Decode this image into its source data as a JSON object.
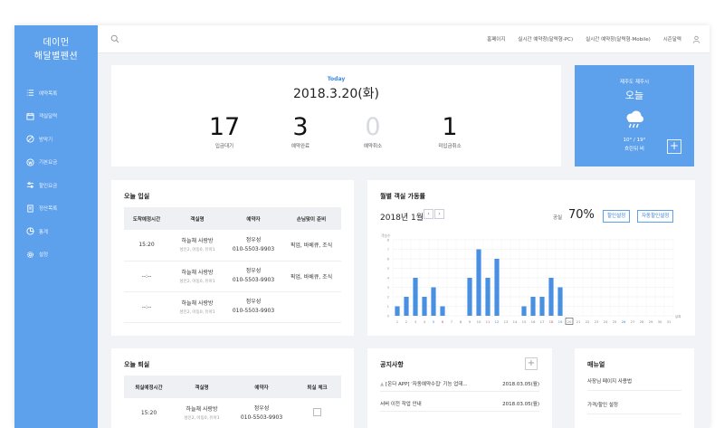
{
  "app": {
    "logo_line1": "데이먼",
    "logo_line2": "해달별펜션"
  },
  "sidebar": {
    "items": [
      {
        "label": "예약목록",
        "icon": "list-icon"
      },
      {
        "label": "객실달력",
        "icon": "calendar-icon"
      },
      {
        "label": "방막기",
        "icon": "block-icon"
      },
      {
        "label": "기본요금",
        "icon": "won-icon"
      },
      {
        "label": "할인요금",
        "icon": "sliders-icon"
      },
      {
        "label": "정산목록",
        "icon": "receipt-icon"
      },
      {
        "label": "통계",
        "icon": "pie-icon"
      },
      {
        "label": "설정",
        "icon": "gear-icon"
      }
    ]
  },
  "topbar": {
    "links": [
      "홈페이지",
      "실시간 예약창(달력형-PC)",
      "실시간 예약창(달력형-Mobile)",
      "시즌달력"
    ]
  },
  "today": {
    "label": "Today",
    "date": "2018.3.20(화)",
    "stats": [
      {
        "value": "17",
        "label": "입금대기"
      },
      {
        "value": "3",
        "label": "예약완료"
      },
      {
        "value": "0",
        "label": "예약취소"
      },
      {
        "value": "1",
        "label": "미입금취소"
      }
    ]
  },
  "weather": {
    "location": "제주도 제주시",
    "day": "오늘",
    "icon": "rain-cloud-icon",
    "temp": "10° / 19°",
    "condition": "흐린뒤 비"
  },
  "checkin": {
    "title": "오늘 입실",
    "headers": [
      "도착예정시간",
      "객실명",
      "예약자",
      "손님맞이 준비"
    ],
    "rows": [
      {
        "time": "15:20",
        "room": "하늘채 사랑방",
        "guests": "성인2, 아동0, 유아1",
        "name": "정우성",
        "phone": "010-5503-9903",
        "prep": "픽업, 바베큐, 조식"
      },
      {
        "time": "--:--",
        "room": "하늘채 사랑방",
        "guests": "성인2, 아동0, 유아1",
        "name": "정우성",
        "phone": "010-5503-9903",
        "prep": "픽업, 바베큐, 조식"
      },
      {
        "time": "--:--",
        "room": "하늘채 사랑방",
        "guests": "성인2, 아동0, 유아1",
        "name": "정우성",
        "phone": "010-5503-9903",
        "prep": ""
      }
    ]
  },
  "checkout": {
    "title": "오늘 퇴실",
    "headers": [
      "퇴실예정시간",
      "객실명",
      "예약자",
      "퇴실 체크"
    ],
    "rows": [
      {
        "time": "15:20",
        "room": "하늘채 사랑방",
        "guests": "성인2, 아동0, 유아1",
        "name": "정우성",
        "phone": "010-5503-9903"
      }
    ]
  },
  "occupancy": {
    "title": "월별 객실 가동률",
    "month": "2018년 1월",
    "prev": "‹",
    "next": "›",
    "rate_label": "공실",
    "rate_value": "70%",
    "btn_discount": "할인설정",
    "btn_auto": "자동할인설정"
  },
  "chart_data": {
    "type": "bar",
    "ylabel": "객실수",
    "xlabel": "날짜",
    "ylim": [
      0,
      8
    ],
    "yticks": [
      "0",
      "1",
      "2",
      "3",
      "4",
      "5",
      "6",
      "7",
      "8"
    ],
    "categories": [
      "1",
      "2",
      "3",
      "4",
      "5",
      "6",
      "7",
      "8",
      "9",
      "10",
      "11",
      "12",
      "13",
      "14",
      "15",
      "16",
      "17",
      "18",
      "19",
      "20",
      "21",
      "22",
      "23",
      "24",
      "25",
      "26",
      "27",
      "28",
      "29",
      "30",
      "31"
    ],
    "values": [
      1,
      2,
      4,
      2,
      3,
      1,
      0,
      0,
      4,
      7,
      4,
      6,
      0,
      0,
      1,
      2,
      2,
      4,
      3,
      0,
      0,
      0,
      0,
      0,
      0,
      0,
      0,
      0,
      0,
      0,
      0
    ],
    "bar_color": "#4a90e2",
    "highlight_day": "20",
    "red_days": [
      "6",
      "11",
      "18"
    ],
    "blue_days": [
      "5",
      "12",
      "19",
      "26"
    ],
    "grid": true
  },
  "notice": {
    "title": "공지사항",
    "plus": "+",
    "items": [
      {
        "text": "[온다 APP] '자동예약수집' 기능 업데...",
        "date": "2018.03.05(월)"
      },
      {
        "text": "서버 이전 작업 안내",
        "date": "2018.03.05(월)"
      }
    ]
  },
  "manual": {
    "title": "매뉴얼",
    "items": [
      "사장님 페이지 사용법",
      "가격/할인 설정"
    ]
  }
}
